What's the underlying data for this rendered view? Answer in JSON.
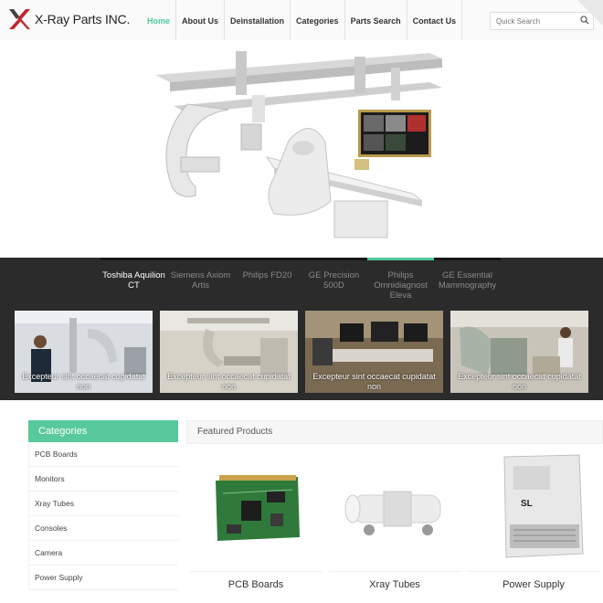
{
  "brand": {
    "name": "X-Ray Parts INC."
  },
  "nav": {
    "items": [
      "Home",
      "About Us",
      "Deinstallation",
      "Categories",
      "Parts Search",
      "Contact Us"
    ]
  },
  "search": {
    "placeholder": "Quick Search"
  },
  "slider": {
    "tabs": [
      {
        "label": "Toshiba Aquilion CT"
      },
      {
        "label": "Siemens Axiom Artis"
      },
      {
        "label": "Philips FD20"
      },
      {
        "label": "GE Precision 500D"
      },
      {
        "label": "Philips Omnidiagnost Eleva"
      },
      {
        "label": "GE Essential Mammography"
      }
    ],
    "thumbs": [
      {
        "caption": "Excepteur sint occaecat cupidatat non"
      },
      {
        "caption": "Excepteur sint occaecat cupidatat non"
      },
      {
        "caption": "Excepteur sint occaecat cupidatat non"
      },
      {
        "caption": "Excepteur sint occaecat cupidatat non"
      }
    ]
  },
  "sidebar": {
    "title": "Categories",
    "items": [
      "PCB Boards",
      "Monitors",
      "Xray Tubes",
      "Consoles",
      "Camera",
      "Power Supply"
    ]
  },
  "featured": {
    "title": "Featured Products",
    "products": [
      {
        "name": "PCB Boards"
      },
      {
        "name": "Xray Tubes"
      },
      {
        "name": "Power Supply"
      }
    ]
  },
  "colors": {
    "accent": "#4ec99a",
    "dark": "#2b2b2b"
  }
}
